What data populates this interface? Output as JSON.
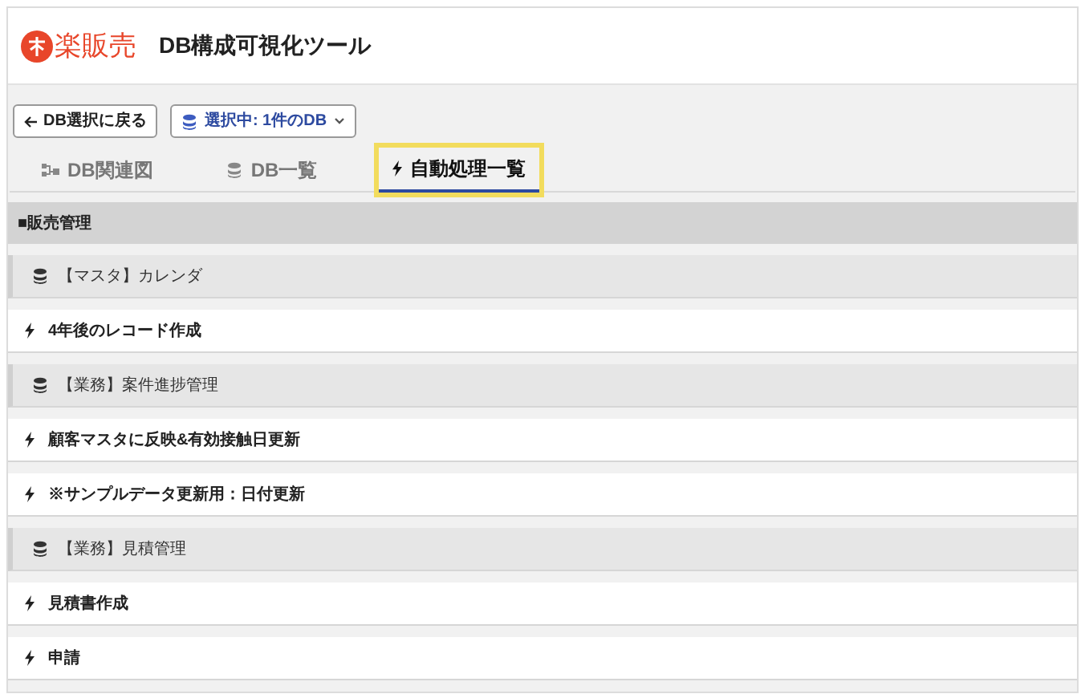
{
  "header": {
    "logo": "楽販売",
    "title": "DB構成可視化ツール"
  },
  "toolbar": {
    "back_button": "DB選択に戻る",
    "selection_button": "選択中: 1件のDB"
  },
  "tabs": [
    {
      "label": "DB関連図",
      "kind": "graph",
      "selected": false
    },
    {
      "label": "DB一覧",
      "kind": "db",
      "selected": false
    },
    {
      "label": "自動処理一覧",
      "kind": "bolt",
      "selected": true
    }
  ],
  "section": {
    "title": "■販売管理"
  },
  "rows": [
    {
      "kind": "db",
      "label": "【マスタ】カレンダ"
    },
    {
      "kind": "action",
      "label": "4年後のレコード作成"
    },
    {
      "kind": "db",
      "label": "【業務】案件進捗管理"
    },
    {
      "kind": "action",
      "label": "顧客マスタに反映&有効接触日更新"
    },
    {
      "kind": "action",
      "label": "※サンプルデータ更新用：日付更新"
    },
    {
      "kind": "db",
      "label": "【業務】見積管理"
    },
    {
      "kind": "action",
      "label": "見積書作成"
    },
    {
      "kind": "action",
      "label": "申請"
    }
  ]
}
